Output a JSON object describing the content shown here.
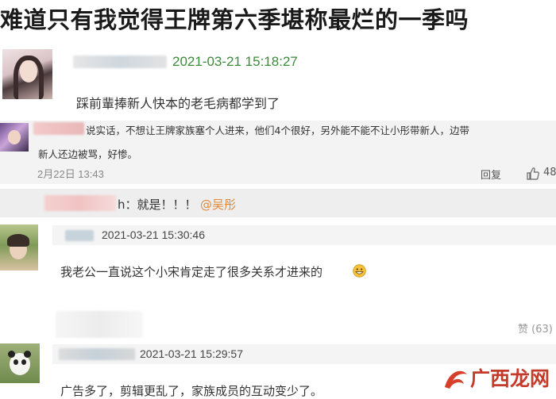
{
  "title": "难道只有我觉得王牌第六季堪称最烂的一季吗",
  "comment1": {
    "timestamp": "2021-03-21 15:18:27",
    "text": "踩前輩捧新人快本的老毛病都学到了"
  },
  "comment2": {
    "line1": "说实话，不想让王牌家族塞个人进来，他们4个很好，另外能不能不让小彤带新人，边带",
    "line2": "新人还边被骂，好惨。",
    "date": "2月22日 13:43",
    "reply_label": "回复",
    "like_count": "48",
    "reply_text": "h：就是！！！",
    "reply_mention": "@吴彤"
  },
  "comment3": {
    "timestamp": "2021-03-21 15:30:46",
    "text": "我老公一直说这个小宋肯定走了很多关系才进来的",
    "like_label": "赞 (63)"
  },
  "comment4": {
    "timestamp": "2021-03-21 15:29:57",
    "text": "广告多了，剪辑更乱了，家族成员的互动变少了。"
  },
  "watermark": {
    "text": "广西龙网"
  },
  "colors": {
    "timestamp_green": "#3c8a3c",
    "link_orange": "#e08a3a",
    "panel_gray": "#f2f2f2"
  }
}
